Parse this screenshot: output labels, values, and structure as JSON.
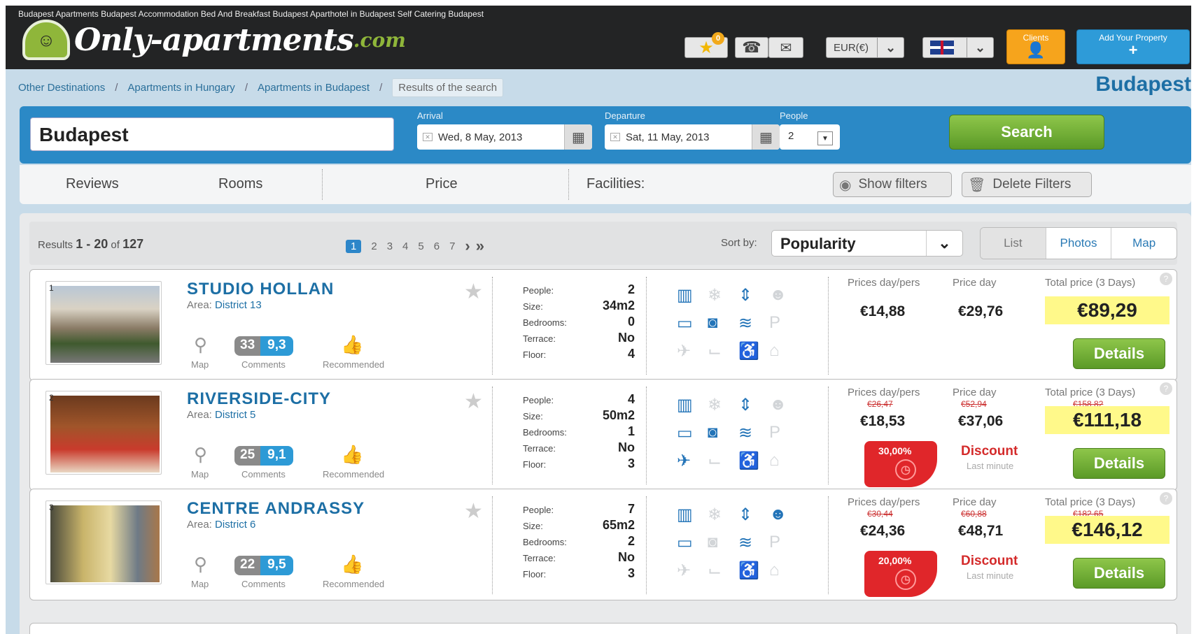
{
  "header": {
    "seo_links": "Budapest Apartments  Budapest Accommodation  Bed And Breakfast Budapest  Aparthotel in Budapest  Self Catering Budapest",
    "logo_main": "Only-apartments",
    "logo_tld": ".com",
    "favorites_count": "0",
    "currency": "EUR(€)",
    "clients_label": "Clients",
    "add_property_label": "Add Your Property"
  },
  "breadcrumb": {
    "items": [
      "Other Destinations",
      "Apartments in Hungary",
      "Apartments in Budapest"
    ],
    "current": "Results of the search"
  },
  "city_title": "Budapest",
  "search": {
    "destination": "Budapest",
    "arrival_label": "Arrival",
    "arrival": "Wed, 8 May, 2013",
    "departure_label": "Departure",
    "departure": "Sat, 11 May, 2013",
    "people_label": "People",
    "people": "2",
    "button": "Search"
  },
  "filters": {
    "tabs": [
      "Reviews",
      "Rooms",
      "Price",
      "Facilities:"
    ],
    "show_filters": "Show filters",
    "delete_filters": "Delete Filters"
  },
  "results": {
    "prefix": "Results",
    "range": "1 - 20",
    "of": "of",
    "total": "127",
    "pages": [
      "1",
      "2",
      "3",
      "4",
      "5",
      "6",
      "7"
    ],
    "sort_label": "Sort by:",
    "sort_value": "Popularity",
    "views": [
      "List",
      "Photos",
      "Map"
    ]
  },
  "labels": {
    "map": "Map",
    "comments": "Comments",
    "recommended": "Recommended",
    "area": "Area:",
    "people": "People:",
    "size": "Size:",
    "bedrooms": "Bedrooms:",
    "terrace": "Terrace:",
    "floor": "Floor:",
    "price_day_pers": "Prices day/pers",
    "price_day": "Price day",
    "total_price": "Total price (3 Days)",
    "details": "Details",
    "discount": "Discount",
    "last_minute": "Last minute"
  },
  "listings": [
    {
      "num": "1",
      "title": "STUDIO HOLLAN",
      "area": "District 13",
      "comments": "33",
      "score": "9,3",
      "people": "2",
      "size": "34m2",
      "bedrooms": "0",
      "terrace": "No",
      "floor": "4",
      "price_pers": "€14,88",
      "price_day": "€29,76",
      "total": "€89,29",
      "old_pers": "",
      "old_day": "",
      "old_total": "",
      "discount_pct": "",
      "facilities_on": [
        true,
        false,
        true,
        false,
        true,
        true,
        true,
        false,
        false,
        false,
        false,
        false
      ]
    },
    {
      "num": "2",
      "title": "RIVERSIDE-CITY",
      "area": "District 5",
      "comments": "25",
      "score": "9,1",
      "people": "4",
      "size": "50m2",
      "bedrooms": "1",
      "terrace": "No",
      "floor": "3",
      "price_pers": "€18,53",
      "price_day": "€37,06",
      "total": "€111,18",
      "old_pers": "€26,47",
      "old_day": "€52,94",
      "old_total": "€158,82",
      "discount_pct": "30,00%",
      "facilities_on": [
        true,
        false,
        true,
        false,
        true,
        true,
        true,
        false,
        true,
        false,
        true,
        false
      ]
    },
    {
      "num": "3",
      "title": "CENTRE ANDRASSY",
      "area": "District 6",
      "comments": "22",
      "score": "9,5",
      "people": "7",
      "size": "65m2",
      "bedrooms": "2",
      "terrace": "No",
      "floor": "3",
      "price_pers": "€24,36",
      "price_day": "€48,71",
      "total": "€146,12",
      "old_pers": "€30,44",
      "old_day": "€60,88",
      "old_total": "€182,65",
      "discount_pct": "20,00%",
      "facilities_on": [
        true,
        false,
        true,
        true,
        true,
        false,
        true,
        false,
        false,
        false,
        false,
        false
      ]
    }
  ],
  "facility_icons": [
    "heating-icon",
    "air-conditioning-icon",
    "elevator-icon",
    "child-icon",
    "tv-icon",
    "washing-machine-icon",
    "wifi-icon",
    "parking-icon",
    "pets-icon",
    "bathtub-icon",
    "wheelchair-icon",
    "pool-icon"
  ]
}
